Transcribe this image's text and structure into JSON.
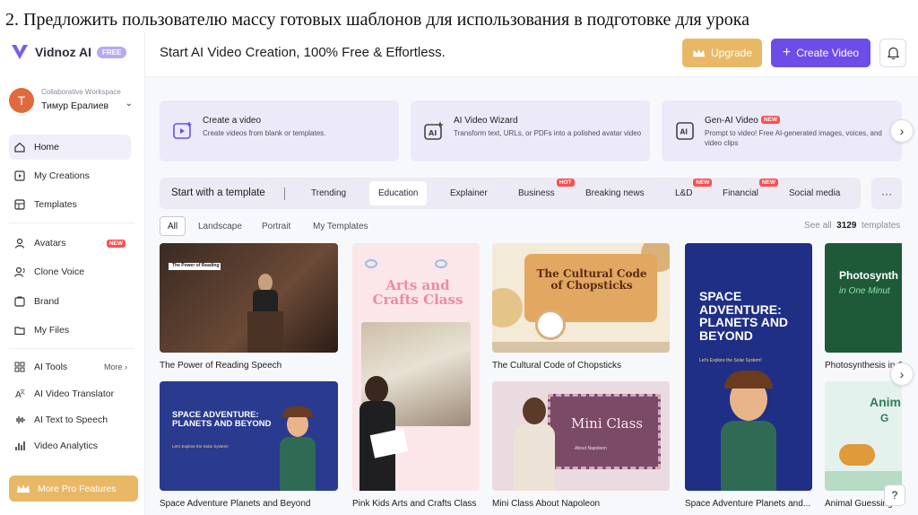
{
  "caption": "2. Предложить пользователю массу готовых шаблонов для использования в подготовке для урока",
  "brand": {
    "name": "Vidnoz AI",
    "badge": "FREE"
  },
  "workspace": {
    "label": "Collaborative Workspace",
    "user": "Тимур Ералиев",
    "initial": "T"
  },
  "nav": {
    "home": "Home",
    "creations": "My Creations",
    "templates": "Templates",
    "avatars": "Avatars",
    "avatars_tag": "NEW",
    "voice": "Clone Voice",
    "brand": "Brand",
    "files": "My Files",
    "tools": "AI Tools",
    "tools_more": "More",
    "translator": "AI Video Translator",
    "tts": "AI Text to Speech",
    "analytics": "Video Analytics",
    "pro": "More Pro Features"
  },
  "topbar": {
    "title": "Start AI Video Creation, 100% Free & Effortless.",
    "upgrade": "Upgrade",
    "create": "Create Video"
  },
  "quick": [
    {
      "title": "Create a video",
      "desc": "Create videos from blank or templates."
    },
    {
      "title": "AI Video Wizard",
      "desc": "Transform text, URLs, or PDFs into a polished avatar video"
    },
    {
      "title": "Gen-AI Video",
      "tag": "NEW",
      "desc": "Prompt to video! Free AI-generated images, voices, and video clips"
    }
  ],
  "categories": {
    "label": "Start with a template",
    "items": [
      "Trending",
      "Education",
      "Explainer",
      "Business",
      "Breaking news",
      "L&D",
      "Financial",
      "Social media"
    ],
    "tags": {
      "business": "HOT",
      "ld": "NEW",
      "financial": "NEW"
    }
  },
  "filters": {
    "all": "All",
    "landscape": "Landscape",
    "portrait": "Portrait",
    "mine": "My Templates"
  },
  "see_all": {
    "prefix": "See all",
    "count": "3129",
    "suffix": "templates"
  },
  "templates": [
    {
      "caption": "The Power of Reading Speech",
      "overlay": "The Power of Reading"
    },
    {
      "caption": "Space Adventure Planets and Beyond",
      "overlay": "SPACE ADVENTURE: PLANETS AND BEYOND",
      "sub": "Let's Explore the Solar System!"
    },
    {
      "caption": "Pink Kids Arts and Crafts Class",
      "overlay": "Arts and Crafts Class"
    },
    {
      "caption": "The Cultural Code of Chopsticks",
      "overlay": "The Cultural Code of Chopsticks"
    },
    {
      "caption": "Mini Class About Napoleon",
      "overlay": "Mini Class",
      "sub": "About Napoleon"
    },
    {
      "caption": "Space Adventure Planets and...",
      "overlay": "SPACE ADVENTURE: PLANETS AND BEYOND",
      "sub": "Let's Explore the Solar System!"
    },
    {
      "caption": "Photosynthesis in O",
      "overlay": "Photosynth",
      "sub": "in One Minut"
    },
    {
      "caption": "Animal Guessing",
      "overlay": "Anim",
      "sub": "G"
    }
  ],
  "colors": {
    "accent": "#6d4de8",
    "gold": "#e9b866",
    "tag_red": "#ff4d4f"
  }
}
